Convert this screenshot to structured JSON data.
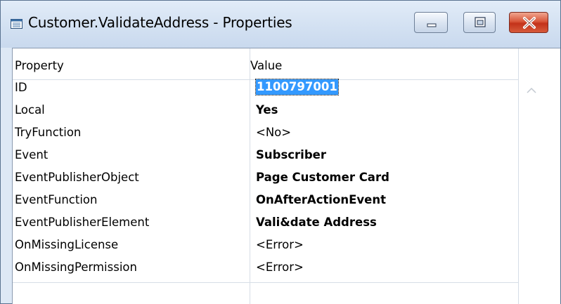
{
  "window": {
    "title": "Customer.ValidateAddress - Properties",
    "icon": "properties-window-icon",
    "buttons": {
      "minimize": "minimize-icon",
      "maximize": "maximize-icon",
      "close": "close-icon"
    },
    "colors": {
      "selection": "#3399ff",
      "close_button": "#d9573a",
      "frame": "#dde8f5"
    }
  },
  "grid": {
    "headers": {
      "property": "Property",
      "value": "Value"
    },
    "rows": [
      {
        "property": "ID",
        "value": "1100797001",
        "bold": true,
        "selected": true
      },
      {
        "property": "Local",
        "value": "Yes",
        "bold": true
      },
      {
        "property": "TryFunction",
        "value": "<No>",
        "bold": false
      },
      {
        "property": "Event",
        "value": "Subscriber",
        "bold": true
      },
      {
        "property": "EventPublisherObject",
        "value": "Page Customer Card",
        "bold": true
      },
      {
        "property": "EventFunction",
        "value": "OnAfterActionEvent",
        "bold": true
      },
      {
        "property": "EventPublisherElement",
        "value": "Vali&date Address",
        "bold": true
      },
      {
        "property": "OnMissingLicense",
        "value": "<Error>",
        "bold": false
      },
      {
        "property": "OnMissingPermission",
        "value": "<Error>",
        "bold": false
      }
    ]
  }
}
